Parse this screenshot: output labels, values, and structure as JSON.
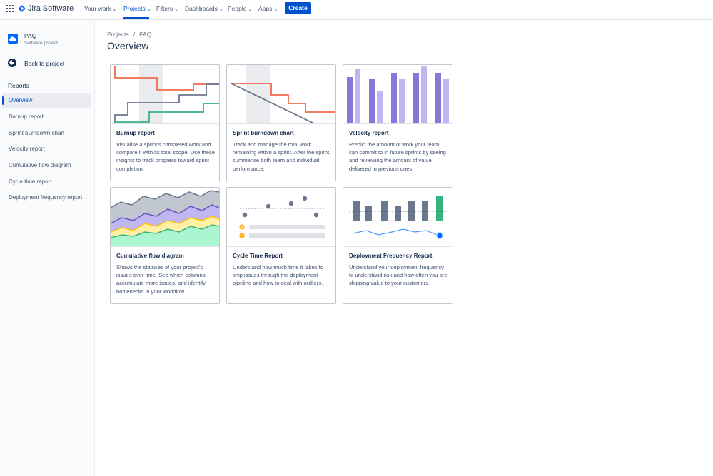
{
  "nav": {
    "product": "Jira Software",
    "items": [
      {
        "label": "Your work"
      },
      {
        "label": "Projects"
      },
      {
        "label": "Filters"
      },
      {
        "label": "Dashboards"
      },
      {
        "label": "People"
      },
      {
        "label": "Apps"
      }
    ],
    "active": "Projects",
    "create_label": "Create"
  },
  "sidebar": {
    "project_name": "PAQ",
    "project_type": "Software project",
    "back_label": "Back to project",
    "group_label": "Reports",
    "items": [
      {
        "label": "Overview",
        "selected": true
      },
      {
        "label": "Burnup report"
      },
      {
        "label": "Sprint burndown chart"
      },
      {
        "label": "Velocity report"
      },
      {
        "label": "Cumulative flow diagram"
      },
      {
        "label": "Cycle time report"
      },
      {
        "label": "Deployment frequency report"
      }
    ]
  },
  "breadcrumb": {
    "items": [
      "Projects",
      "FAQ"
    ],
    "separator": "/"
  },
  "page": {
    "title": "Overview"
  },
  "cards": [
    {
      "title": "Burnup report",
      "description": "Visualise a sprint's completed work and compare it with its total scope. Use these insights to track progress toward sprint completion."
    },
    {
      "title": "Sprint burndown chart",
      "description": "Track and manage the total work remaining within a sprint. After the sprint, summarise both team and individual performance."
    },
    {
      "title": "Velocity report",
      "description": "Predict the amount of work your team can commit to in future sprints by seeing and reviewing the amount of value delivered in previous ones."
    },
    {
      "title": "Cumulative flow diagram",
      "description": "Shows the statuses of your project's issues over time. See which columns accumulate more issues, and identify bottlenecks in your workflow."
    },
    {
      "title": "Cycle Time Report",
      "description": "Understand how much time it takes to ship issues through the deployment pipeline and how to deal with outliers."
    },
    {
      "title": "Deployment Frequency Report",
      "description": "Understand your deployment frequency to understand risk and how often you are shipping value to your customers."
    }
  ],
  "colors": {
    "brand_blue": "#0052cc",
    "orange": "#f36a4f",
    "green": "#36b37e",
    "slate": "#6b778c",
    "purple": "#8777d9",
    "light_purple": "#c0b6f2",
    "yellow": "#fff0a6",
    "mint": "#abf5d1"
  }
}
